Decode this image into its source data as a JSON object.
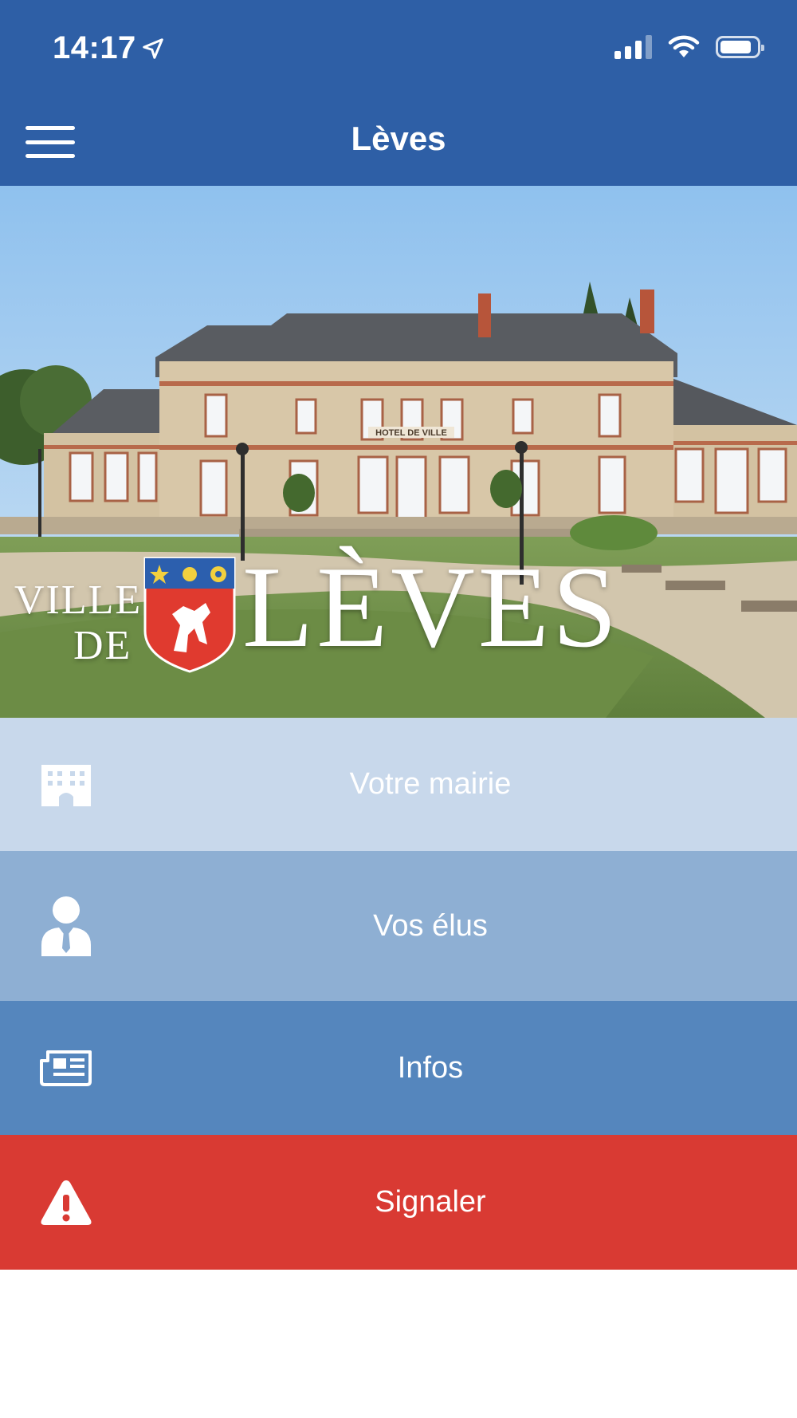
{
  "status_bar": {
    "time": "14:17",
    "location_icon": "location-arrow-icon",
    "signal_icon": "cellular-signal-icon",
    "wifi_icon": "wifi-icon",
    "battery_icon": "battery-icon",
    "signal_bars_active": 3,
    "battery_level_fraction": 0.75
  },
  "header": {
    "title": "Lèves",
    "menu_icon": "hamburger-menu-icon",
    "background_color": "#2e5fa6"
  },
  "hero": {
    "logo_ville": "VILLE",
    "logo_de": "DE",
    "logo_name": "LÈVES",
    "building_sign": "HOTEL DE VILLE",
    "crest_icon": "coat-of-arms-icon"
  },
  "menu": {
    "items": [
      {
        "label": "Votre mairie",
        "icon": "town-hall-building-icon",
        "color": "#c8d8eb"
      },
      {
        "label": "Vos élus",
        "icon": "person-suit-icon",
        "color": "#8eafd3"
      },
      {
        "label": "Infos",
        "icon": "newspaper-icon",
        "color": "#5586bd"
      },
      {
        "label": "Signaler",
        "icon": "warning-triangle-icon",
        "color": "#d93a33"
      }
    ]
  }
}
